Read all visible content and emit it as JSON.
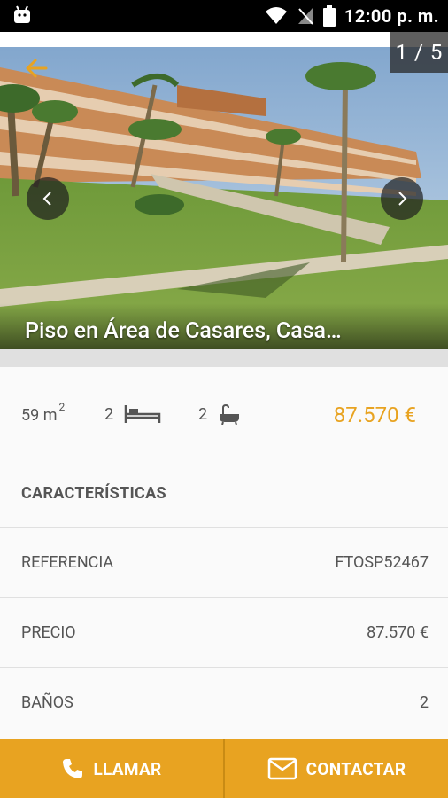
{
  "status_bar": {
    "time": "12:00 p. m."
  },
  "gallery": {
    "counter": "1 / 5",
    "caption": "Piso en Área de Casares, Casa…"
  },
  "summary": {
    "area_value": "59 m",
    "area_sup": "2",
    "bedrooms": "2",
    "bathrooms": "2",
    "price": "87.570 €"
  },
  "section": {
    "title": "CARACTERÍSTICAS"
  },
  "details": [
    {
      "label": "REFERENCIA",
      "value": "FTOSP52467"
    },
    {
      "label": "PRECIO",
      "value": "87.570 €"
    },
    {
      "label": "BAÑOS",
      "value": "2"
    }
  ],
  "actions": {
    "call_label": "LLAMAR",
    "contact_label": "CONTACTAR"
  },
  "colors": {
    "accent": "#e8a321",
    "text": "#555555",
    "divider": "#e0e0e0"
  },
  "icons": [
    "android-icon",
    "wifi-icon",
    "signal-icon",
    "battery-icon",
    "back-arrow-icon",
    "chevron-left-icon",
    "chevron-right-icon",
    "bed-icon",
    "bathtub-icon",
    "phone-icon",
    "mail-icon"
  ]
}
